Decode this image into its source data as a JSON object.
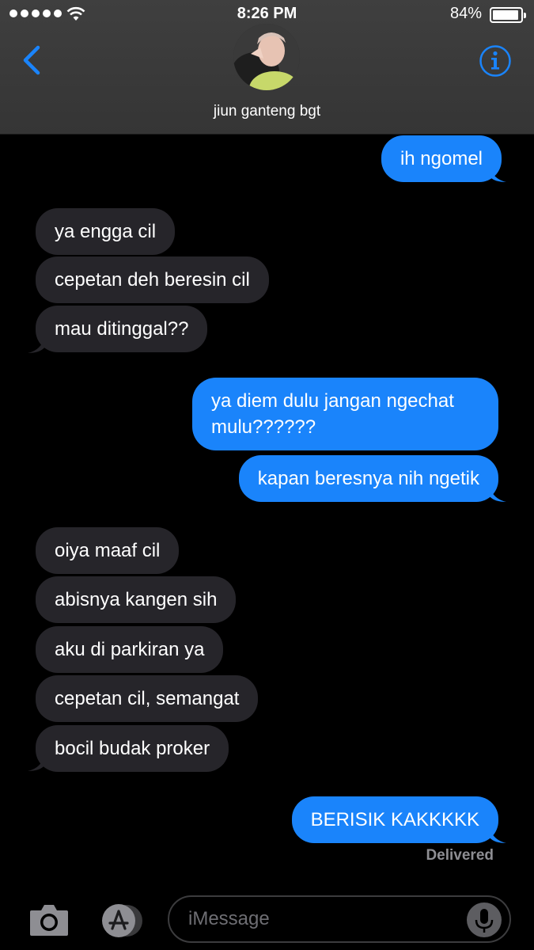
{
  "status_bar": {
    "time": "8:26 PM",
    "battery": "84%"
  },
  "header": {
    "contact_name": "jiun ganteng bgt"
  },
  "messages": [
    {
      "side": "out",
      "text": "ih ngomel"
    },
    {
      "side": "in",
      "text": "ya engga cil"
    },
    {
      "side": "in",
      "text": "cepetan deh beresin cil"
    },
    {
      "side": "in",
      "text": "mau ditinggal??"
    },
    {
      "side": "out",
      "line1": "ya diem dulu jangan ngechat",
      "line2": "mulu??????"
    },
    {
      "side": "out",
      "text": "kapan beresnya nih ngetik"
    },
    {
      "side": "in",
      "text": "oiya maaf cil"
    },
    {
      "side": "in",
      "text": "abisnya kangen sih"
    },
    {
      "side": "in",
      "text": "aku di parkiran ya"
    },
    {
      "side": "in",
      "text": "cepetan cil, semangat"
    },
    {
      "side": "in",
      "text": "bocil budak proker"
    },
    {
      "side": "out",
      "text": "BERISIK KAKKKKK"
    }
  ],
  "delivered": "Delivered",
  "composer": {
    "placeholder": "iMessage"
  },
  "colors": {
    "outgoing": "#1a84fb",
    "incoming": "#26252a",
    "accent": "#1a84fb"
  },
  "icons": [
    "back-chevron-icon",
    "info-icon",
    "camera-icon",
    "app-store-icon",
    "microphone-icon",
    "wifi-icon",
    "battery-icon"
  ]
}
